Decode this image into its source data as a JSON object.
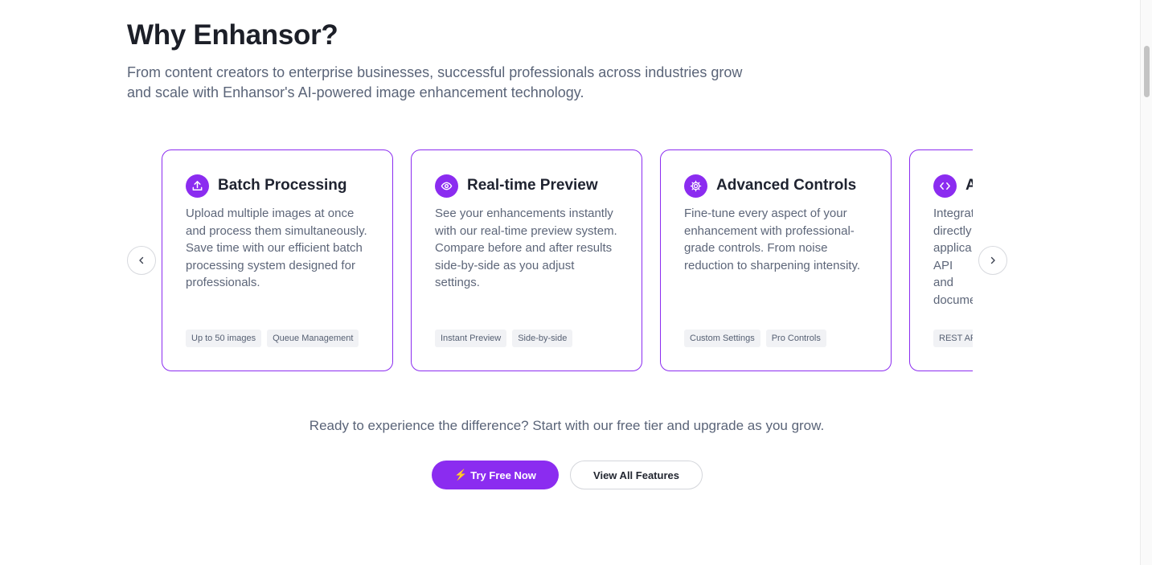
{
  "section": {
    "title": "Why Enhansor?",
    "subtitle": "From content creators to enterprise businesses, successful professionals across industries grow and scale with Enhansor's AI-powered image enhancement technology."
  },
  "cards": [
    {
      "icon": "upload-icon",
      "title": "Batch Processing",
      "description": "Upload multiple images at once and process them simultaneously. Save time with our efficient batch processing system designed for professionals.",
      "tags": [
        "Up to 50 images",
        "Queue Management"
      ]
    },
    {
      "icon": "eye-icon",
      "title": "Real-time Preview",
      "description": "See your enhancements instantly with our real-time preview system. Compare before and after results side-by-side as you adjust settings.",
      "tags": [
        "Instant Preview",
        "Side-by-side"
      ]
    },
    {
      "icon": "gear-icon",
      "title": "Advanced Controls",
      "description": "Fine-tune every aspect of your enhancement with professional-grade controls. From noise reduction to sharpening intensity.",
      "tags": [
        "Custom Settings",
        "Pro Controls"
      ]
    },
    {
      "icon": "code-icon",
      "title": "A",
      "description": "Integrat directly applica API and docume",
      "tags": [
        "REST AP"
      ]
    }
  ],
  "carousel": {
    "prev_icon": "chevron-left-icon",
    "next_icon": "chevron-right-icon"
  },
  "cta": {
    "text": "Ready to experience the difference? Start with our free tier and upgrade as you grow.",
    "primary_icon": "⚡",
    "primary_label": "Try Free Now",
    "secondary_label": "View All Features"
  },
  "colors": {
    "accent": "#8b2cf0",
    "text_muted": "#5a6478",
    "tag_bg": "#f1f2f5"
  }
}
